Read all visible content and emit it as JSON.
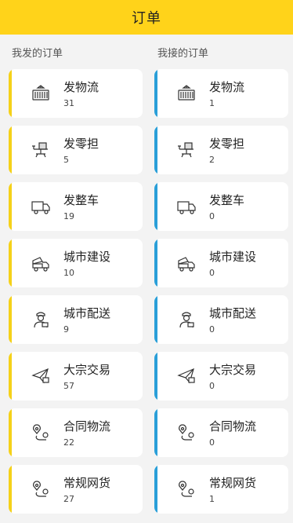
{
  "header": {
    "title": "订单"
  },
  "sent": {
    "title": "我发的订单",
    "items": [
      {
        "label": "发物流",
        "count": "31",
        "icon": "container-icon"
      },
      {
        "label": "发零担",
        "count": "5",
        "icon": "scale-icon"
      },
      {
        "label": "发整车",
        "count": "19",
        "icon": "truck-icon"
      },
      {
        "label": "城市建设",
        "count": "10",
        "icon": "dump-truck-icon"
      },
      {
        "label": "城市配送",
        "count": "9",
        "icon": "courier-icon"
      },
      {
        "label": "大宗交易",
        "count": "57",
        "icon": "paper-plane-icon"
      },
      {
        "label": "合同物流",
        "count": "22",
        "icon": "route-icon"
      },
      {
        "label": "常规网货",
        "count": "27",
        "icon": "route-icon"
      }
    ]
  },
  "received": {
    "title": "我接的订单",
    "items": [
      {
        "label": "发物流",
        "count": "1",
        "icon": "container-icon"
      },
      {
        "label": "发零担",
        "count": "2",
        "icon": "scale-icon"
      },
      {
        "label": "发整车",
        "count": "0",
        "icon": "truck-icon"
      },
      {
        "label": "城市建设",
        "count": "0",
        "icon": "dump-truck-icon"
      },
      {
        "label": "城市配送",
        "count": "0",
        "icon": "courier-icon"
      },
      {
        "label": "大宗交易",
        "count": "0",
        "icon": "paper-plane-icon"
      },
      {
        "label": "合同物流",
        "count": "0",
        "icon": "route-icon"
      },
      {
        "label": "常规网货",
        "count": "1",
        "icon": "route-icon"
      }
    ]
  },
  "colors": {
    "header": "#ffd31a",
    "sent_accent": "#f5d119",
    "received_accent": "#2a9fd8"
  }
}
